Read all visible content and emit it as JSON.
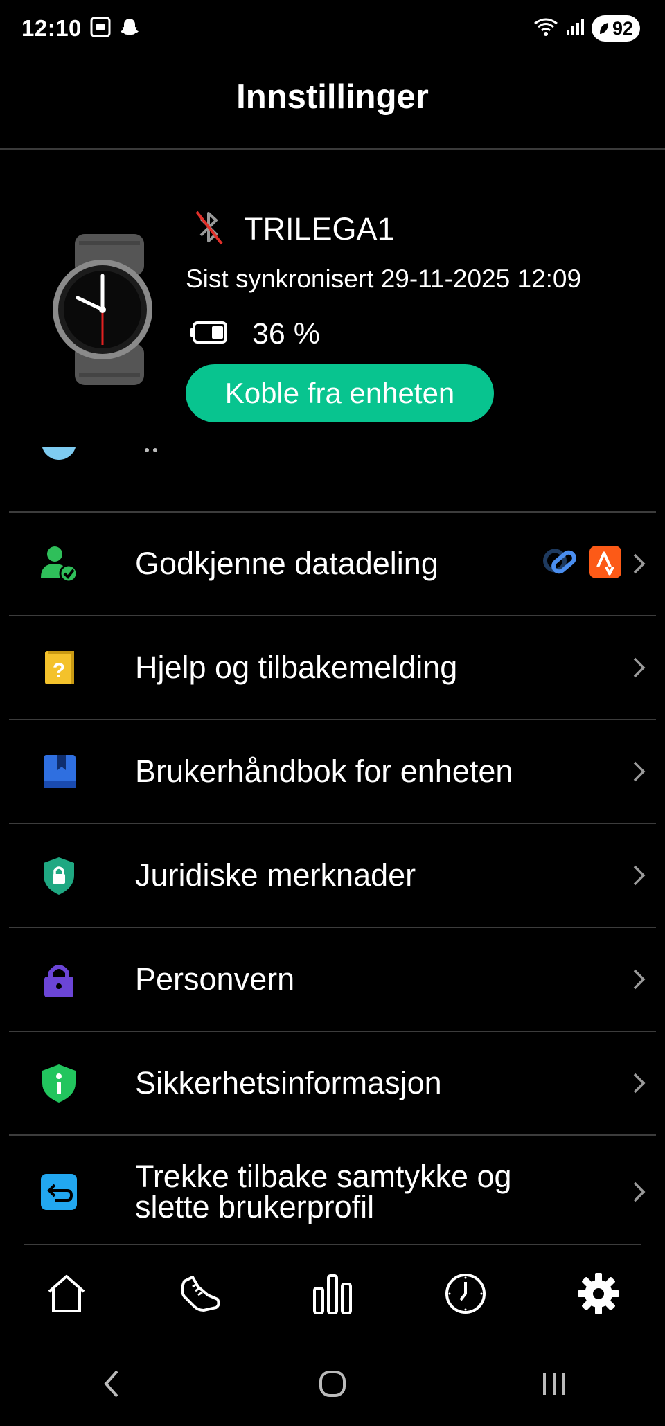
{
  "status_bar": {
    "time": "12:10",
    "battery": "92",
    "wifi_label": "5"
  },
  "header": {
    "title": "Innstillinger"
  },
  "device": {
    "name": "TRILEGA1",
    "sync_text": "Sist synkronisert 29-11-2025 12:09",
    "battery_text": "36 %",
    "disconnect_label": "Koble fra enheten",
    "accent_color": "#08c48f"
  },
  "menu": {
    "items": [
      {
        "label": "Godkjenne datadeling",
        "icon": "user-check-icon"
      },
      {
        "label": "Hjelp og tilbakemelding",
        "icon": "help-doc-icon"
      },
      {
        "label": "Brukerhåndbok for enheten",
        "icon": "book-icon"
      },
      {
        "label": "Juridiske merknader",
        "icon": "shield-lock-icon"
      },
      {
        "label": "Personvern",
        "icon": "padlock-icon"
      },
      {
        "label": "Sikkerhetsinformasjon",
        "icon": "shield-info-icon"
      },
      {
        "label_line1": "Trekke tilbake samtykke og",
        "label_line2": "slette brukerprofil",
        "icon": "return-arrow-icon"
      }
    ]
  },
  "bottom_nav": {
    "items": [
      "home-icon",
      "shoe-icon",
      "bar-chart-icon",
      "clock-icon",
      "gear-icon"
    ],
    "active": "gear-icon"
  },
  "system_nav": [
    "back-icon",
    "home-circle-icon",
    "recents-icon"
  ]
}
